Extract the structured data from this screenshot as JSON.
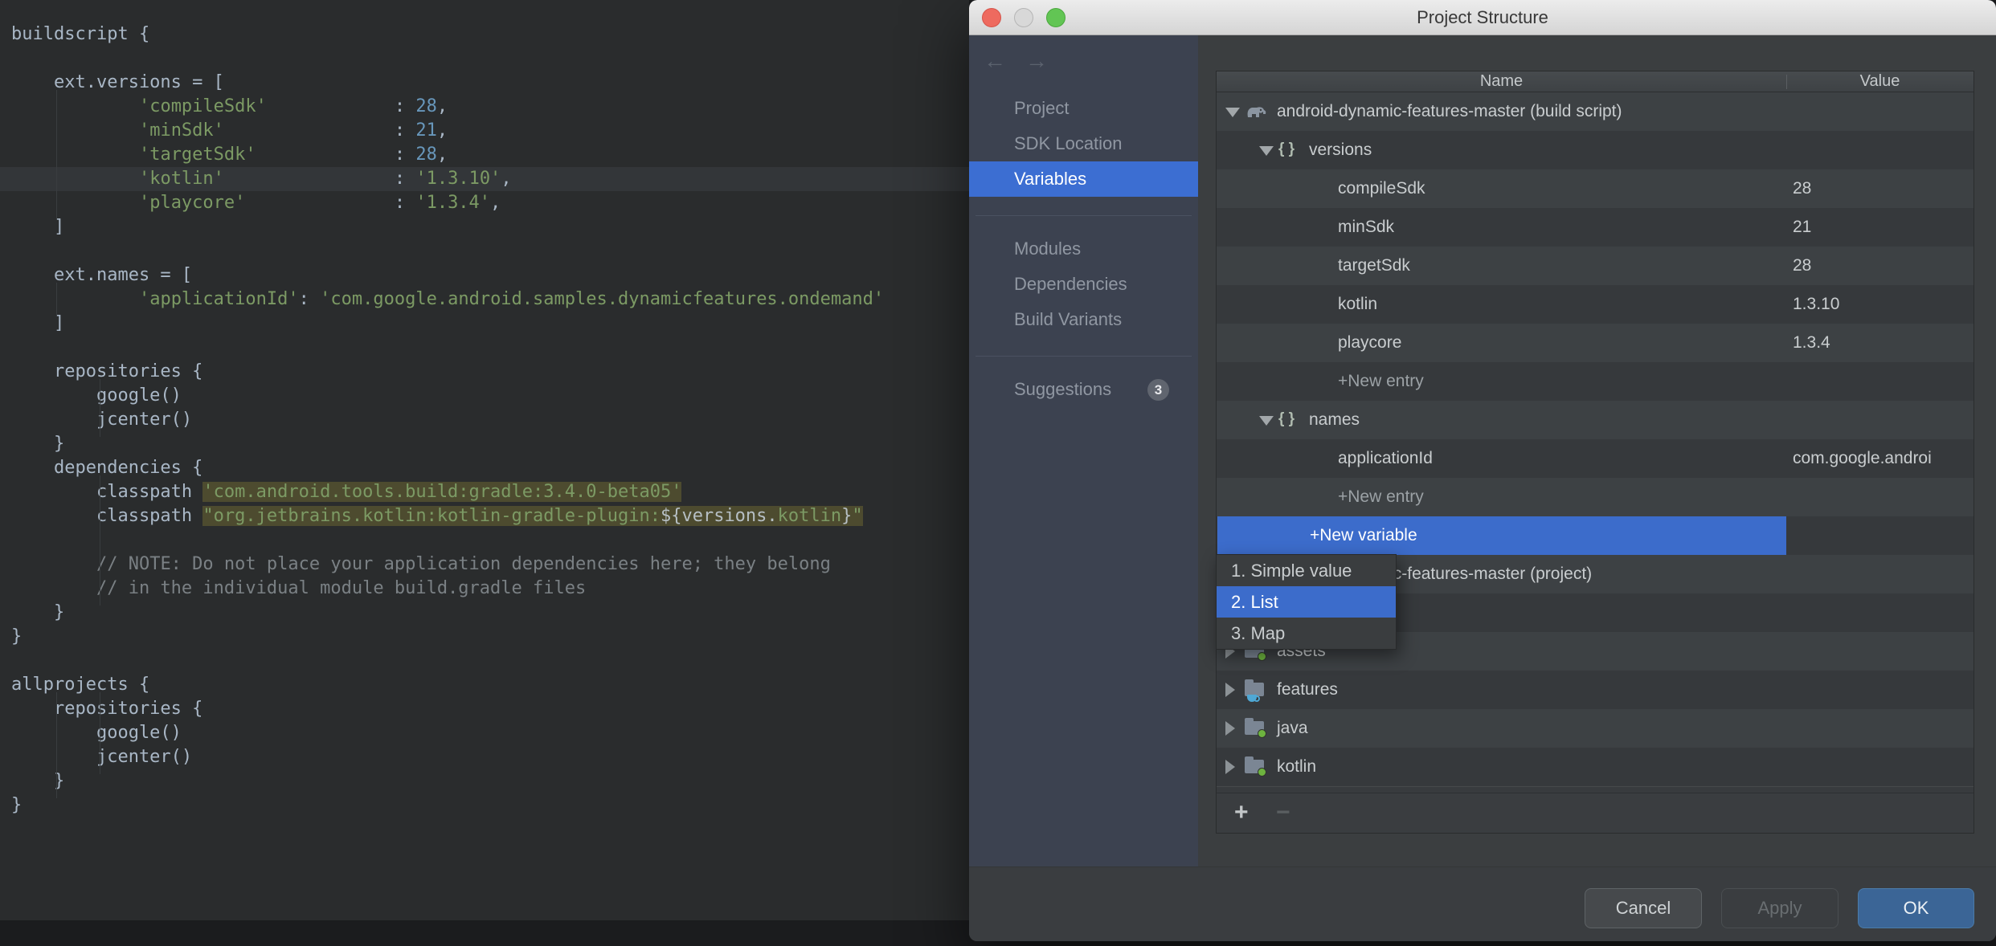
{
  "colors": {
    "selection-blue": "#3C6CCB",
    "sidebar-bg": "#3C4250",
    "row-light": "#3D4144",
    "row-dark": "#36393C",
    "panel-bg": "#3B3E40",
    "ok-blue": "#3B6596",
    "string-green": "#7C9A64",
    "number-blue": "#6897BB",
    "comment-gray": "#7A8084",
    "editor-bg": "#2A2C2D",
    "olive": "#4D4B2F",
    "badge-bg": "#60656F",
    "traffic-red": "#EE6A5F",
    "traffic-gray": "#D8D8D8",
    "traffic-green": "#62C554"
  },
  "editor": {
    "lines": [
      {
        "fold": true,
        "s": [
          [
            "p",
            "buildscript {"
          ]
        ]
      },
      {
        "s": []
      },
      {
        "s": [
          [
            "p",
            "    ext.versions = ["
          ]
        ]
      },
      {
        "s": [
          [
            "p",
            "            "
          ],
          [
            "str",
            "'compileSdk'"
          ],
          [
            "p",
            "            : "
          ],
          [
            "num",
            "28"
          ],
          [
            "p",
            ","
          ]
        ]
      },
      {
        "s": [
          [
            "p",
            "            "
          ],
          [
            "str",
            "'minSdk'"
          ],
          [
            "p",
            "                : "
          ],
          [
            "num",
            "21"
          ],
          [
            "p",
            ","
          ]
        ]
      },
      {
        "s": [
          [
            "p",
            "            "
          ],
          [
            "str",
            "'targetSdk'"
          ],
          [
            "p",
            "             : "
          ],
          [
            "num",
            "28"
          ],
          [
            "p",
            ","
          ]
        ]
      },
      {
        "hl": true,
        "s": [
          [
            "p",
            "            "
          ],
          [
            "str",
            "'kotlin'"
          ],
          [
            "p",
            "                : "
          ],
          [
            "str",
            "'1.3.10'"
          ],
          [
            "p",
            ","
          ]
        ]
      },
      {
        "s": [
          [
            "p",
            "            "
          ],
          [
            "str",
            "'playcore'"
          ],
          [
            "p",
            "              : "
          ],
          [
            "str",
            "'1.3.4'"
          ],
          [
            "p",
            ","
          ]
        ]
      },
      {
        "s": [
          [
            "p",
            "    ]"
          ]
        ]
      },
      {
        "s": []
      },
      {
        "s": [
          [
            "p",
            "    ext.names = ["
          ]
        ]
      },
      {
        "s": [
          [
            "p",
            "            "
          ],
          [
            "str",
            "'applicationId'"
          ],
          [
            "p",
            ": "
          ],
          [
            "str",
            "'com.google.android.samples.dynamicfeatures.ondemand'"
          ]
        ]
      },
      {
        "s": [
          [
            "p",
            "    ]"
          ]
        ]
      },
      {
        "s": []
      },
      {
        "fold": true,
        "s": [
          [
            "p",
            "    repositories {"
          ]
        ]
      },
      {
        "s": [
          [
            "p",
            "        google()"
          ]
        ]
      },
      {
        "s": [
          [
            "p",
            "        jcenter()"
          ]
        ]
      },
      {
        "fold": true,
        "s": [
          [
            "p",
            "    }"
          ]
        ]
      },
      {
        "fold": true,
        "s": [
          [
            "p",
            "    dependencies {"
          ]
        ]
      },
      {
        "s": [
          [
            "p",
            "        classpath "
          ],
          [
            "strh",
            "'com.android.tools.build:gradle:3.4.0-beta05'"
          ]
        ]
      },
      {
        "s": [
          [
            "p",
            "        classpath "
          ],
          [
            "strh",
            "\"org.jetbrains.kotlin:kotlin-gradle-plugin:"
          ],
          [
            "ph",
            "${versions."
          ],
          [
            "strh",
            "kotlin"
          ],
          [
            "ph",
            "}"
          ],
          [
            "strh",
            "\""
          ]
        ]
      },
      {
        "s": []
      },
      {
        "fold": true,
        "s": [
          [
            "p",
            "        "
          ],
          [
            "com",
            "// NOTE: Do not place your application dependencies here; they belong"
          ]
        ]
      },
      {
        "fold": true,
        "s": [
          [
            "p",
            "        "
          ],
          [
            "com",
            "// in the individual module build.gradle files"
          ]
        ]
      },
      {
        "fold": true,
        "s": [
          [
            "p",
            "    }"
          ]
        ]
      },
      {
        "fold": true,
        "s": [
          [
            "p",
            "}"
          ]
        ]
      },
      {
        "s": []
      },
      {
        "fold": true,
        "s": [
          [
            "p",
            "allprojects {"
          ]
        ]
      },
      {
        "fold": true,
        "s": [
          [
            "p",
            "    repositories {"
          ]
        ]
      },
      {
        "s": [
          [
            "p",
            "        google()"
          ]
        ]
      },
      {
        "s": [
          [
            "p",
            "        jcenter()"
          ]
        ]
      },
      {
        "fold": true,
        "s": [
          [
            "p",
            "    }"
          ]
        ]
      },
      {
        "fold": true,
        "s": [
          [
            "p",
            "}"
          ]
        ]
      }
    ]
  },
  "dialog": {
    "title": "Project Structure",
    "traffic_lights": [
      "close",
      "minimize",
      "zoom"
    ],
    "sidebar": {
      "back": "←",
      "forward": "→",
      "items": [
        {
          "type": "item",
          "label": "Project"
        },
        {
          "type": "item",
          "label": "SDK Location"
        },
        {
          "type": "item",
          "label": "Variables",
          "selected": true
        },
        {
          "type": "separator"
        },
        {
          "type": "item",
          "label": "Modules"
        },
        {
          "type": "item",
          "label": "Dependencies"
        },
        {
          "type": "item",
          "label": "Build Variants"
        },
        {
          "type": "separator"
        },
        {
          "type": "item",
          "label": "Suggestions",
          "badge": "3"
        }
      ]
    },
    "table": {
      "columns": [
        "Name",
        "Value"
      ],
      "rows": [
        {
          "stripe": "L",
          "indent": 0,
          "arrow": "expanded",
          "icon": "gradle",
          "name": "android-dynamic-features-master (build script)",
          "value": ""
        },
        {
          "stripe": "D",
          "indent": 1,
          "arrow": "expanded",
          "icon": "braces",
          "name": "versions",
          "value": ""
        },
        {
          "stripe": "L",
          "indent": 2,
          "name": "compileSdk",
          "value": "28"
        },
        {
          "stripe": "D",
          "indent": 2,
          "name": "minSdk",
          "value": "21"
        },
        {
          "stripe": "L",
          "indent": 2,
          "name": "targetSdk",
          "value": "28"
        },
        {
          "stripe": "D",
          "indent": 2,
          "name": "kotlin",
          "value": "1.3.10"
        },
        {
          "stripe": "L",
          "indent": 2,
          "name": "playcore",
          "value": "1.3.4"
        },
        {
          "stripe": "D",
          "indent": 2,
          "name": "+New entry",
          "dim": true,
          "value": ""
        },
        {
          "stripe": "L",
          "indent": 1,
          "arrow": "expanded",
          "icon": "braces",
          "name": "names",
          "value": ""
        },
        {
          "stripe": "D",
          "indent": 2,
          "name": "applicationId",
          "value": "com.google.androi"
        },
        {
          "stripe": "L",
          "indent": 2,
          "name": "+New entry",
          "dim": true,
          "value": ""
        },
        {
          "stripe": "D",
          "indent": 1,
          "name": "+New variable",
          "selected": true,
          "value": ""
        },
        {
          "stripe": "L",
          "indent": 0,
          "arrow": "expanded",
          "icon": "gradle",
          "name": "android-dynamic-features-master (project)",
          "value": ""
        },
        {
          "stripe": "D",
          "indent": 0,
          "name": "",
          "value": ""
        },
        {
          "stripe": "L",
          "indent": 0,
          "arrow": "collapsed",
          "icon": "folder-green",
          "name": "assets",
          "value": ""
        },
        {
          "stripe": "D",
          "indent": 0,
          "arrow": "collapsed",
          "icon": "folder-cup",
          "name": "features",
          "value": ""
        },
        {
          "stripe": "L",
          "indent": 0,
          "arrow": "collapsed",
          "icon": "folder-green",
          "name": "java",
          "value": ""
        },
        {
          "stripe": "D",
          "indent": 0,
          "arrow": "collapsed",
          "icon": "folder-green",
          "name": "kotlin",
          "value": ""
        }
      ]
    },
    "popup": {
      "items": [
        {
          "label": "1. Simple value"
        },
        {
          "label": "2. List",
          "selected": true
        },
        {
          "label": "3. Map"
        }
      ]
    },
    "toolbar": {
      "add": "+",
      "remove": "−"
    },
    "buttons": [
      {
        "id": "cancel",
        "label": "Cancel",
        "kind": "normal"
      },
      {
        "id": "apply",
        "label": "Apply",
        "kind": "disabled"
      },
      {
        "id": "ok",
        "label": "OK",
        "kind": "primary"
      }
    ]
  }
}
